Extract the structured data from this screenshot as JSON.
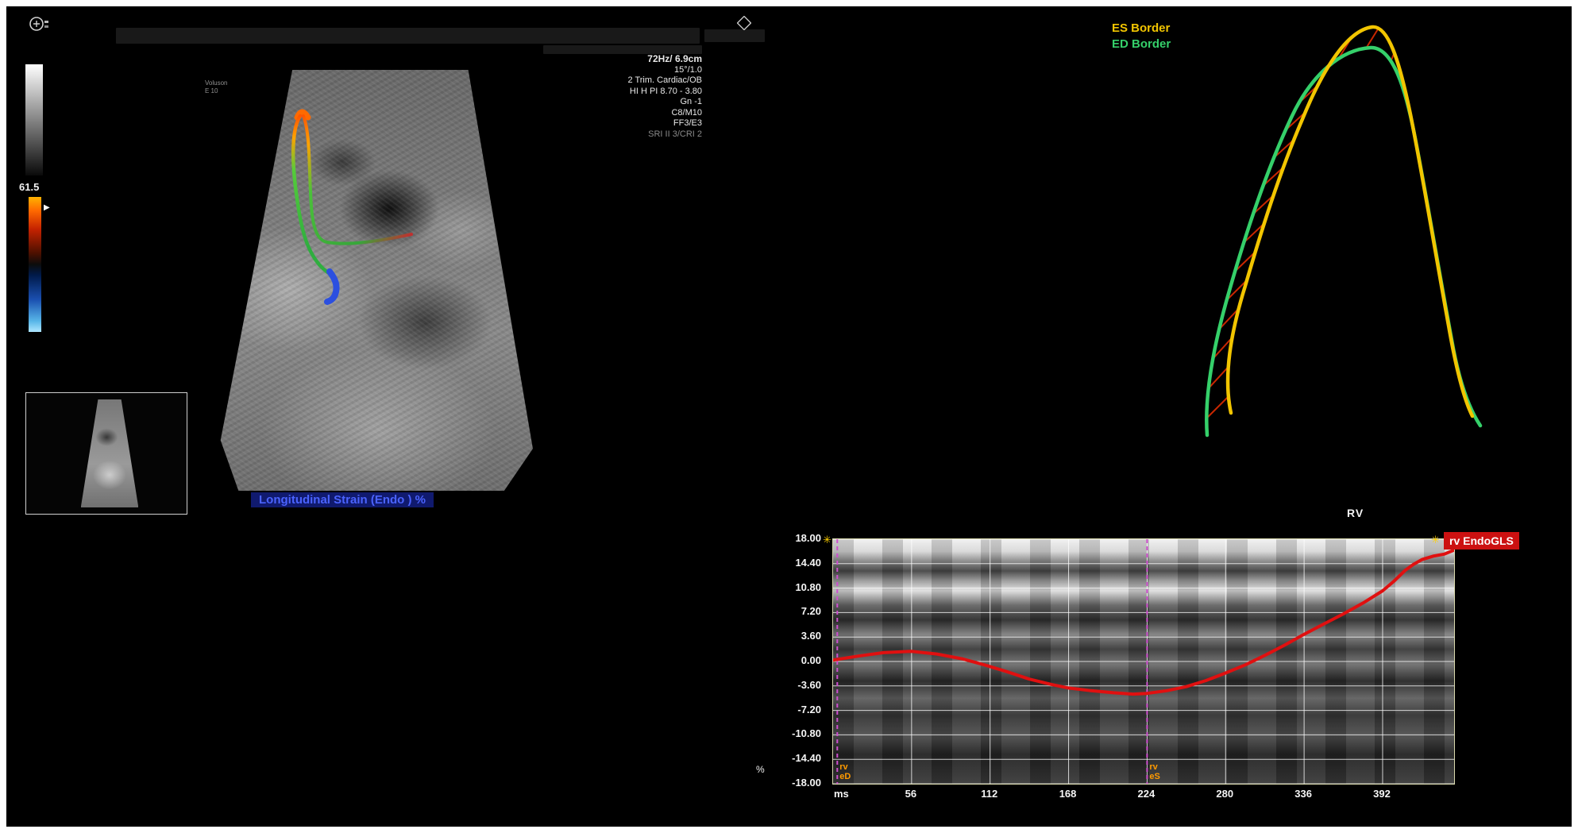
{
  "colors": {
    "es_border": "#f2c500",
    "ed_border": "#35d06a",
    "strain_curve": "#e01010",
    "phase_marker": "#cf4fcf",
    "phase_label": "#ff9a00",
    "badge_bg": "#cc1111",
    "caption_text": "#4a63ff",
    "caption_bg": "#101a6e"
  },
  "header": {
    "gray_map_value": "61.5"
  },
  "image_info": {
    "lines": [
      "72Hz/ 6.9cm",
      "15°/1.0",
      "2 Trim. Cardiac/OB",
      "HI H PI 8.70 - 3.80",
      "Gn -1",
      "C8/M10",
      "FF3/E3",
      "SRI II 3/CRI 2"
    ]
  },
  "ultrasound": {
    "caption": "Longitudinal Strain (Endo ) %",
    "watermark_line1": "Voluson",
    "watermark_line2": "E 10"
  },
  "borders_legend": {
    "es_label": "ES Border",
    "ed_label": "ED Border",
    "region_label": "RV"
  },
  "chart_data": {
    "type": "line",
    "badge": "rv EndoGLS",
    "xlabel": "ms",
    "ylabel": "%",
    "xlim": [
      0,
      443
    ],
    "ylim": [
      -18,
      18
    ],
    "x_ticks": [
      56,
      112,
      168,
      224,
      280,
      336,
      392
    ],
    "y_tick_labels": [
      "18.00",
      "14.40",
      "10.80",
      "7.20",
      "3.60",
      "0.00",
      "-3.60",
      "-7.20",
      "-10.80",
      "-14.40",
      "-18.00"
    ],
    "markers": [
      {
        "lines": [
          "rv",
          "eD"
        ],
        "ms": 3
      },
      {
        "lines": [
          "rv",
          "eS"
        ],
        "ms": 224
      }
    ],
    "series": [
      {
        "name": "rv EndoGLS",
        "color": "#e01010",
        "points": [
          [
            0,
            0.2
          ],
          [
            18,
            0.8
          ],
          [
            36,
            1.3
          ],
          [
            56,
            1.5
          ],
          [
            74,
            1.1
          ],
          [
            92,
            0.4
          ],
          [
            108,
            -0.5
          ],
          [
            124,
            -1.5
          ],
          [
            140,
            -2.6
          ],
          [
            156,
            -3.4
          ],
          [
            168,
            -3.9
          ],
          [
            184,
            -4.3
          ],
          [
            200,
            -4.6
          ],
          [
            214,
            -4.8
          ],
          [
            224,
            -4.7
          ],
          [
            238,
            -4.3
          ],
          [
            252,
            -3.7
          ],
          [
            266,
            -2.8
          ],
          [
            280,
            -1.7
          ],
          [
            294,
            -0.5
          ],
          [
            308,
            0.9
          ],
          [
            322,
            2.4
          ],
          [
            336,
            4.0
          ],
          [
            350,
            5.5
          ],
          [
            364,
            7.0
          ],
          [
            378,
            8.6
          ],
          [
            392,
            10.4
          ],
          [
            400,
            11.8
          ],
          [
            408,
            13.4
          ],
          [
            414,
            14.3
          ],
          [
            420,
            15.0
          ],
          [
            428,
            15.5
          ],
          [
            436,
            15.8
          ],
          [
            443,
            16.4
          ]
        ]
      }
    ]
  }
}
